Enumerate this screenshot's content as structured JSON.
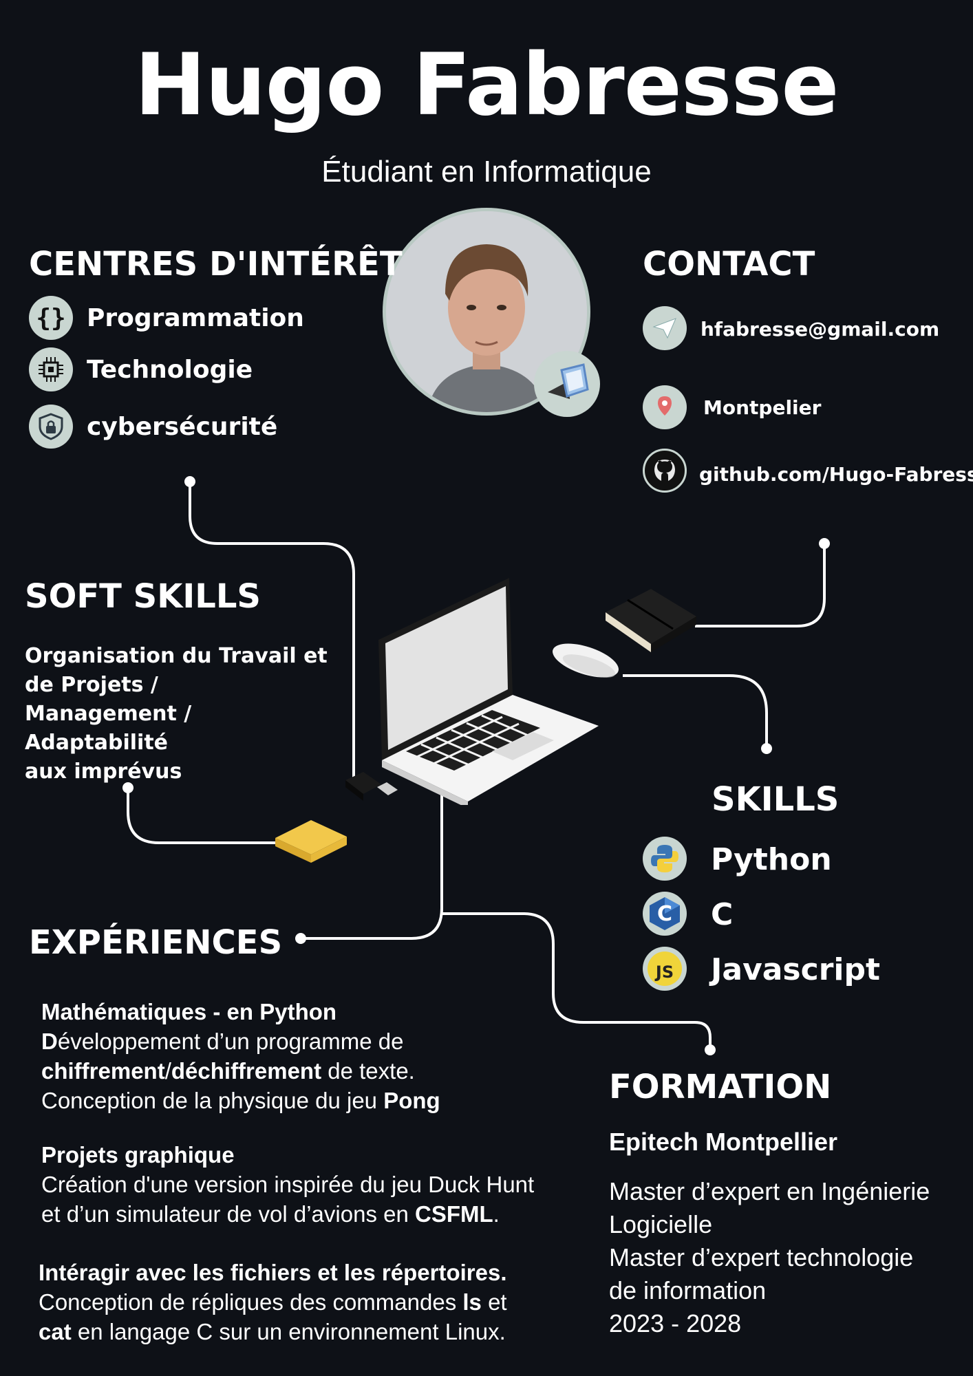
{
  "header": {
    "name": "Hugo Fabresse",
    "title": "Étudiant en Informatique"
  },
  "interests": {
    "heading": "CENTRES D'INTÉRÊT",
    "items": [
      {
        "label": "Programmation",
        "icon": "braces-icon"
      },
      {
        "label": "Technologie",
        "icon": "chip-icon"
      },
      {
        "label": "cybersécurité",
        "icon": "shield-lock-icon"
      }
    ]
  },
  "contact": {
    "heading": "CONTACT",
    "email": "hfabresse@gmail.com",
    "location": "Montpelier",
    "github": "github.com/Hugo-Fabresse"
  },
  "soft_skills": {
    "heading": "SOFT SKILLS",
    "lines": [
      "Organisation du Travail et",
      "de Projets /",
      "Management / Adaptabilité",
      "aux imprévus"
    ]
  },
  "skills": {
    "heading": "SKILLS",
    "items": [
      {
        "label": "Python",
        "icon": "python-icon"
      },
      {
        "label": "C",
        "icon": "c-language-icon"
      },
      {
        "label": "Javascript",
        "icon": "javascript-icon"
      }
    ]
  },
  "experiences": {
    "heading": "EXPÉRIENCES",
    "exp1": {
      "title": "Mathématiques - en Python",
      "l1a": "D",
      "l1b": "éveloppement d’un programme de",
      "l2a": "chiffrement",
      "l2b": "/",
      "l2c": "déchiffrement",
      "l2d": " de texte.",
      "l3a": "Conception de la physique du jeu ",
      "l3b": "Pong"
    },
    "exp2": {
      "title": "Projets graphique",
      "l1": "Création d'une version inspirée du jeu Duck Hunt",
      "l2a": "et d’un simulateur de vol d’avions en ",
      "l2b": "CSFML",
      "l2c": "."
    },
    "exp3": {
      "title": "Intéragir avec les fichiers et les répertoires.",
      "l1a": "Conception de répliques des commandes ",
      "l1b": "ls",
      "l1c": " et",
      "l2a": "cat",
      "l2b": " en langage C sur un environnement Linux."
    }
  },
  "formation": {
    "heading": "FORMATION",
    "school": "Epitech Montpellier",
    "lines": [
      "Master d’expert en Ingénierie",
      "Logicielle",
      "Master d’expert technologie",
      "de information",
      "2023 - 2028"
    ]
  },
  "colors": {
    "background": "#0e1117",
    "text": "#ffffff",
    "icon_bg": "#c9d6d1",
    "sticky_note": "#f2c84b"
  }
}
